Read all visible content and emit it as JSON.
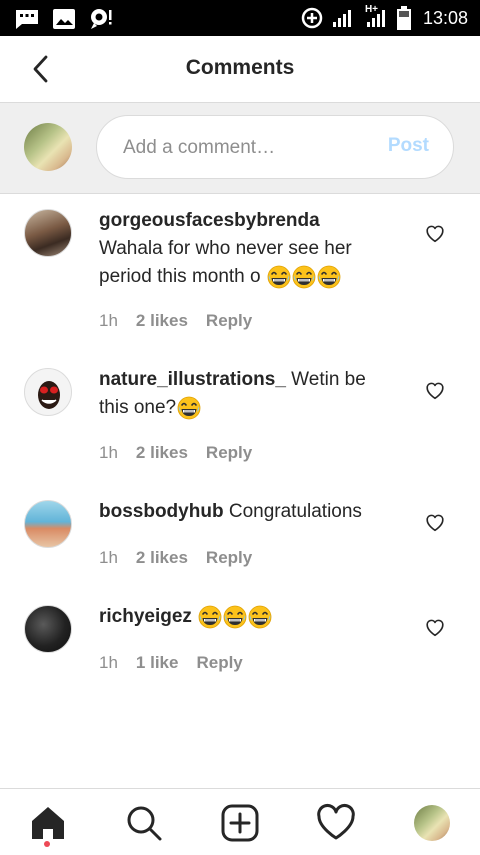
{
  "status_bar": {
    "time": "13:08",
    "network": "H+",
    "icons": [
      "message-icon",
      "image-icon",
      "location-alert-icon",
      "data-saver-icon",
      "signal-icon",
      "signal-icon",
      "battery-icon"
    ]
  },
  "header": {
    "title": "Comments",
    "back_icon": "chevron-left-icon"
  },
  "composer": {
    "placeholder": "Add a comment…",
    "post_label": "Post",
    "post_color": "#b3dbff"
  },
  "comments": [
    {
      "username": "gorgeousfacesbybrenda",
      "text": "Wahala for who never see her period this month o",
      "emoji_count": 3,
      "time": "1h",
      "likes": "2 likes",
      "reply": "Reply"
    },
    {
      "username": "nature_illustrations_",
      "text": "Wetin be this one?",
      "emoji_count": 1,
      "time": "1h",
      "likes": "2 likes",
      "reply": "Reply"
    },
    {
      "username": "bossbodyhub",
      "text": "Congratulations",
      "emoji_count": 0,
      "time": "1h",
      "likes": "2 likes",
      "reply": "Reply"
    },
    {
      "username": "richyeigez",
      "text": "",
      "emoji_count": 3,
      "time": "1h",
      "likes": "1 like",
      "reply": "Reply"
    }
  ],
  "bottom_nav": {
    "items": [
      "home-icon",
      "search-icon",
      "new-post-icon",
      "activity-heart-icon",
      "profile-avatar"
    ],
    "active": "home-icon",
    "notification_dot_color": "#ed4956"
  },
  "colors": {
    "text": "#262626",
    "secondary": "#8e8e8e",
    "divider": "#dbdbdb",
    "composer_bg": "#efefef"
  }
}
